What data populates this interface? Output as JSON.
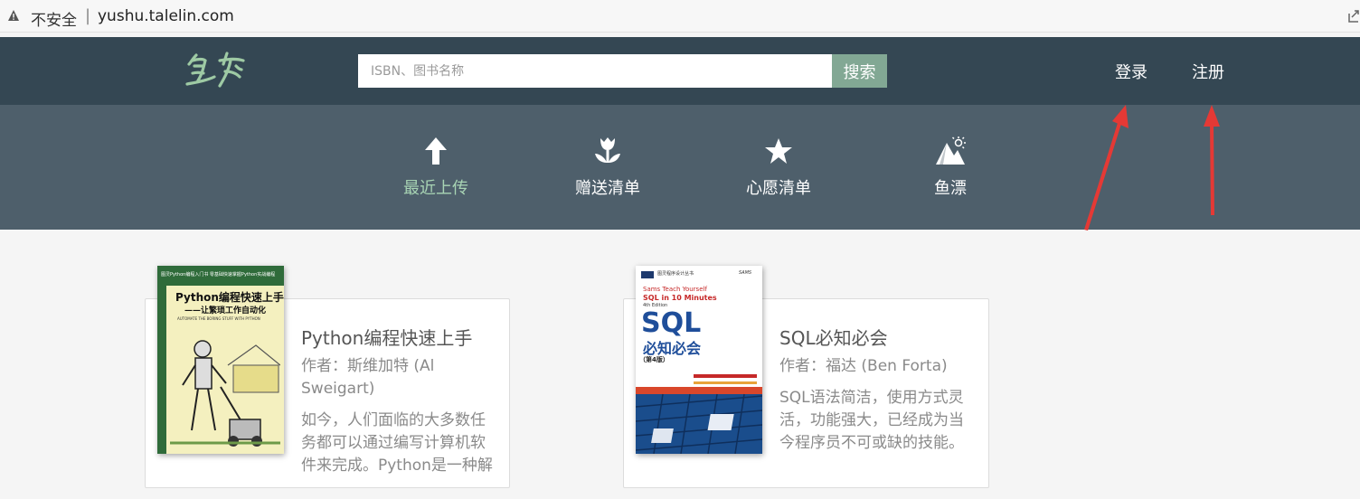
{
  "browser": {
    "security_label": "不安全",
    "separator": "|",
    "url": "yushu.talelin.com"
  },
  "header": {
    "logo_text": "鱼书",
    "search": {
      "placeholder": "ISBN、图书名称",
      "value": "",
      "button_label": "搜索"
    },
    "links": {
      "login": "登录",
      "register": "注册"
    }
  },
  "subnav": {
    "items": [
      {
        "label": "最近上传",
        "icon": "upload-arrow-icon",
        "active": true
      },
      {
        "label": "赠送清单",
        "icon": "flower-icon",
        "active": false
      },
      {
        "label": "心愿清单",
        "icon": "star-icon",
        "active": false
      },
      {
        "label": "鱼漂",
        "icon": "mountain-sun-icon",
        "active": false
      }
    ],
    "active_color": "#a8d4b4"
  },
  "books": [
    {
      "title": "Python编程快速上手",
      "author": "作者：斯维加特 (Al Sweigart)",
      "summary": "如今，人们面临的大多数任务都可以通过编写计算机软件来完成。Python是一种解",
      "cover": {
        "top_line": "图灵Python编程入门书 零基础快速掌握Python实战编程",
        "title": "Python编程快速上手",
        "subtitle": "——让繁琐工作自动化",
        "english": "AUTOMATE THE BORING STUFF WITH PYTHON"
      }
    },
    {
      "title": "SQL必知必会",
      "author": "作者：福达 (Ben Forta)",
      "summary": "SQL语法简洁，使用方式灵活，功能强大，已经成为当今程序员不可或缺的技能。",
      "cover": {
        "series": "图灵程序设计丛书",
        "publisher": "SAMS",
        "sams_line": "Sams Teach Yourself",
        "en_title": "SQL in 10 Minutes",
        "edition_en": "4th Edition",
        "big_title": "SQL",
        "cn_title": "必知必会",
        "edition_cn": "（第4版）"
      }
    }
  ],
  "colors": {
    "header_bg": "#344753",
    "subnav_bg": "#4e5f6b",
    "search_button": "#82a894",
    "annotation_arrow": "#e53935"
  }
}
